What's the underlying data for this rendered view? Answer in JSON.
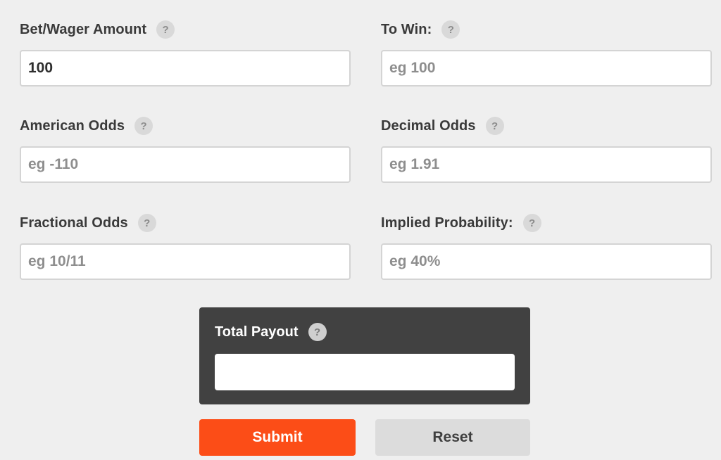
{
  "fields": {
    "bet_amount": {
      "label": "Bet/Wager Amount",
      "value": "100",
      "placeholder": ""
    },
    "to_win": {
      "label": "To Win:",
      "value": "",
      "placeholder": "eg 100"
    },
    "american_odds": {
      "label": "American Odds",
      "value": "",
      "placeholder": "eg -110"
    },
    "decimal_odds": {
      "label": "Decimal Odds",
      "value": "",
      "placeholder": "eg 1.91"
    },
    "fractional_odds": {
      "label": "Fractional Odds",
      "value": "",
      "placeholder": "eg 10/11"
    },
    "implied_probability": {
      "label": "Implied Probability:",
      "value": "",
      "placeholder": "eg 40%"
    }
  },
  "help_icon_glyph": "?",
  "payout": {
    "label": "Total Payout",
    "value": ""
  },
  "buttons": {
    "submit": "Submit",
    "reset": "Reset"
  },
  "colors": {
    "accent": "#fc4d17",
    "payout_bg": "#414141",
    "page_bg": "#efefef"
  }
}
